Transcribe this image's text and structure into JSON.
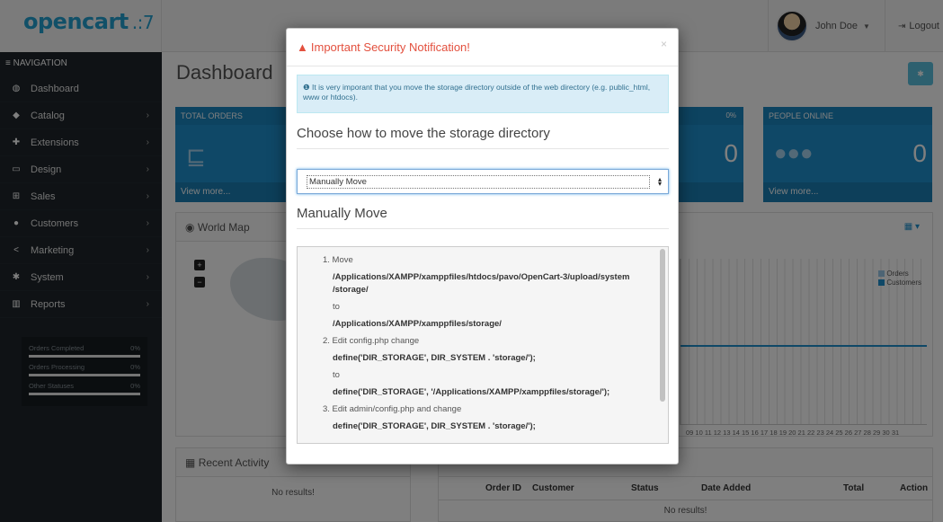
{
  "header": {
    "logo_text": "opencart",
    "logo_cart": ".:7",
    "user_name": "John Doe",
    "logout_label": "Logout"
  },
  "sidebar": {
    "nav_heading": "NAVIGATION",
    "items": [
      {
        "label": "Dashboard",
        "icon": "dashboard-icon"
      },
      {
        "label": "Catalog",
        "icon": "tag-icon"
      },
      {
        "label": "Extensions",
        "icon": "puzzle-icon"
      },
      {
        "label": "Design",
        "icon": "monitor-icon"
      },
      {
        "label": "Sales",
        "icon": "cart-icon"
      },
      {
        "label": "Customers",
        "icon": "user-icon"
      },
      {
        "label": "Marketing",
        "icon": "share-icon"
      },
      {
        "label": "System",
        "icon": "cog-icon"
      },
      {
        "label": "Reports",
        "icon": "bar-chart-icon"
      }
    ],
    "stats": [
      {
        "label": "Orders Completed",
        "value": "0%"
      },
      {
        "label": "Orders Processing",
        "value": "0%"
      },
      {
        "label": "Other Statuses",
        "value": "0%"
      }
    ]
  },
  "main": {
    "title": "Dashboard",
    "tiles": [
      {
        "head": "TOTAL ORDERS",
        "foot": "View more..."
      },
      {
        "pct": "0%",
        "num": "0"
      },
      {
        "head": "PEOPLE ONLINE",
        "num": "0",
        "foot": "View more..."
      }
    ],
    "world_map_title": "World Map",
    "chart_legend": [
      "Orders",
      "Customers"
    ],
    "chart_xticks": "09 10 11 12 13 14 15 16 17 18 19 20 21 22 23 24 25 26 27 28 29 30 31",
    "recent_activity_title": "Recent Activity",
    "no_results": "No results!",
    "orders_table": {
      "columns": [
        "Order ID",
        "Customer",
        "Status",
        "Date Added",
        "Total",
        "Action"
      ],
      "empty": "No results!"
    }
  },
  "modal": {
    "title": "Important Security Notification!",
    "info": "It is very imporant that you move the storage directory outside of the web directory (e.g. public_html, www or htdocs).",
    "choose_title": "Choose how to move the storage directory",
    "select_value": "Manually Move",
    "manual_title": "Manually Move",
    "steps": {
      "s1": "1. Move",
      "s1_path": "/Applications/XAMPP/xamppfiles/htdocs/pavo/OpenCart-3/upload/system /storage/",
      "to1": "to",
      "s1_dest": "/Applications/XAMPP/xamppfiles/storage/",
      "s2": "2. Edit config.php change",
      "s2_from": "define('DIR_STORAGE', DIR_SYSTEM . 'storage/');",
      "to2": "to",
      "s2_to": "define('DIR_STORAGE', '/Applications/XAMPP/xamppfiles/storage/');",
      "s3": "3. Edit admin/config.php and change",
      "s3_from": "define('DIR_STORAGE', DIR_SYSTEM . 'storage/');"
    },
    "colors": {
      "warning": "#e3503e",
      "info_bg": "#d9edf7",
      "brand": "#1e91cf"
    }
  }
}
